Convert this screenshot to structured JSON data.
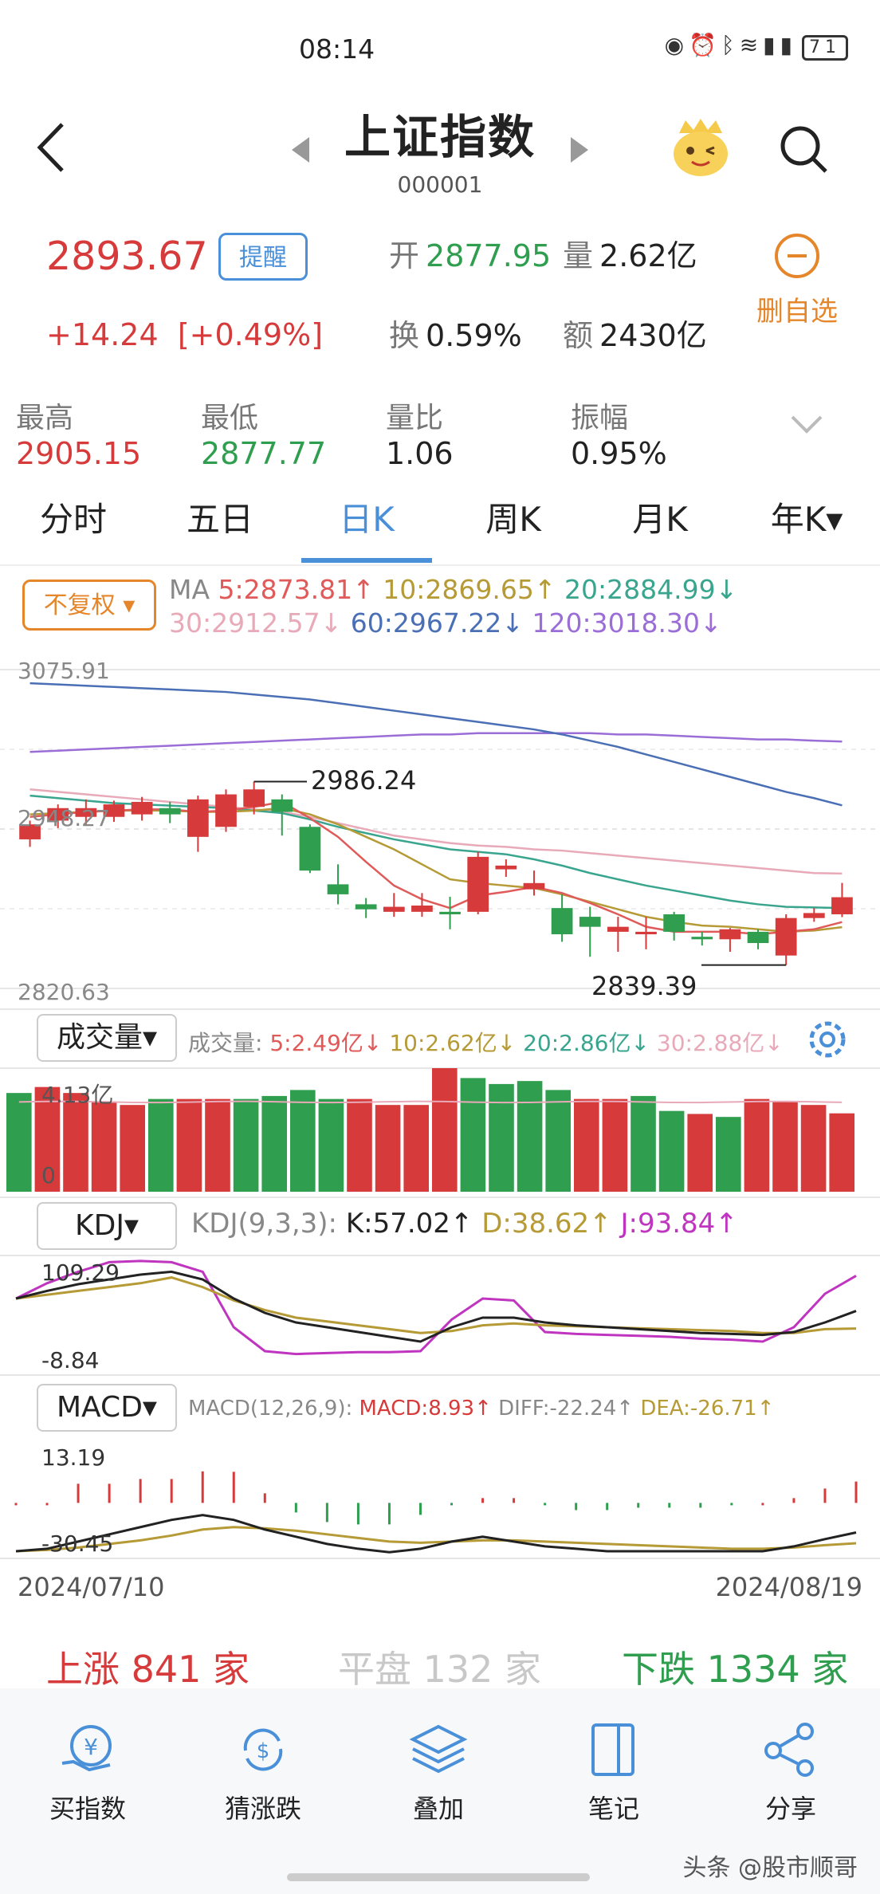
{
  "status_bar": {
    "time": "08:14",
    "battery": "71"
  },
  "header": {
    "title": "上证指数",
    "code": "000001"
  },
  "quote": {
    "price": "2893.67",
    "alert_label": "提醒",
    "change": "+14.24",
    "change_pct": "[+0.49%]",
    "open_label": "开",
    "open": "2877.95",
    "volume_label": "量",
    "volume": "2.62亿",
    "turnover_label": "换",
    "turnover": "0.59%",
    "amount_label": "额",
    "amount": "2430亿",
    "remove_watchlist": "删自选"
  },
  "stats": [
    {
      "label": "最高",
      "value": "2905.15",
      "color": "#d63a3a"
    },
    {
      "label": "最低",
      "value": "2877.77",
      "color": "#2f9e4f"
    },
    {
      "label": "量比",
      "value": "1.06",
      "color": "#222222"
    },
    {
      "label": "振幅",
      "value": "0.95%",
      "color": "#222222"
    }
  ],
  "tabs": [
    "分时",
    "五日",
    "日K",
    "周K",
    "月K",
    "年K▾"
  ],
  "active_tab": "日K",
  "kline": {
    "adjust_label": "不复权",
    "ma_prefix": "MA",
    "ma5": "5:2873.81↑",
    "ma10": "10:2869.65↑",
    "ma20": "20:2884.99↓",
    "ma30": "30:2912.57↓",
    "ma60": "60:2967.22↓",
    "ma120": "120:3018.30↓",
    "y_top": "3075.91",
    "y_mid": "2948.27",
    "y_bottom": "2820.63",
    "max_annotation": "2986.24",
    "min_annotation": "2839.39"
  },
  "volume": {
    "selector": "成交量▾",
    "line": "成交量: ",
    "v5": "5:2.49亿↓",
    "v10": "10:2.62亿↓",
    "v20": "20:2.86亿↓",
    "v30": "30:2.88亿↓",
    "y_top": "4.13亿",
    "y_bottom": "0"
  },
  "kdj": {
    "selector": "KDJ▾",
    "params": "KDJ(9,3,3):",
    "k": "K:57.02↑",
    "d": "D:38.62↑",
    "j": "J:93.84↑",
    "y_top": "109.29",
    "y_bottom": "-8.84"
  },
  "macd": {
    "selector": "MACD▾",
    "params": "MACD(12,26,9):",
    "macd": "MACD:8.93↑",
    "diff": "DIFF:-22.24↑",
    "dea": "DEA:-26.71↑",
    "y_top": "13.19",
    "y_bottom": "-30.45"
  },
  "dates": {
    "start": "2024/07/10",
    "end": "2024/08/19"
  },
  "breadth": {
    "up": "上涨 841 家",
    "flat": "平盘 132 家",
    "down": "下跌 1334 家"
  },
  "bottom_nav": [
    "买指数",
    "猜涨跌",
    "叠加",
    "笔记",
    "分享"
  ],
  "watermark": "头条 @股市顺哥",
  "colors": {
    "up": "#d63a3a",
    "down": "#2f9e4f",
    "accent": "#4a90d9",
    "orange": "#e5862a"
  },
  "chart_data": {
    "type": "candlestick",
    "x_range": [
      "2024/07/10",
      "2024/08/19"
    ],
    "ylim": [
      2820.63,
      3075.91
    ],
    "candles": [
      {
        "o": 2940,
        "c": 2952,
        "h": 2955,
        "l": 2934
      },
      {
        "o": 2955,
        "c": 2965,
        "h": 2968,
        "l": 2949
      },
      {
        "o": 2958,
        "c": 2965,
        "h": 2972,
        "l": 2951
      },
      {
        "o": 2958,
        "c": 2968,
        "h": 2971,
        "l": 2954
      },
      {
        "o": 2960,
        "c": 2970,
        "h": 2974,
        "l": 2955
      },
      {
        "o": 2965,
        "c": 2960,
        "h": 2970,
        "l": 2953
      },
      {
        "o": 2942,
        "c": 2972,
        "h": 2975,
        "l": 2930
      },
      {
        "o": 2950,
        "c": 2976,
        "h": 2980,
        "l": 2946
      },
      {
        "o": 2966,
        "c": 2980,
        "h": 2986.24,
        "l": 2960
      },
      {
        "o": 2972,
        "c": 2962,
        "h": 2976,
        "l": 2943
      },
      {
        "o": 2950,
        "c": 2915,
        "h": 2952,
        "l": 2913
      },
      {
        "o": 2904,
        "c": 2896,
        "h": 2920,
        "l": 2888
      },
      {
        "o": 2888,
        "c": 2884,
        "h": 2893,
        "l": 2877
      },
      {
        "o": 2882,
        "c": 2886,
        "h": 2897,
        "l": 2878
      },
      {
        "o": 2882,
        "c": 2887,
        "h": 2897,
        "l": 2878
      },
      {
        "o": 2882,
        "c": 2880,
        "h": 2894,
        "l": 2868
      },
      {
        "o": 2882,
        "c": 2926,
        "h": 2930,
        "l": 2880
      },
      {
        "o": 2916,
        "c": 2919,
        "h": 2924,
        "l": 2910
      },
      {
        "o": 2900,
        "c": 2905,
        "h": 2915,
        "l": 2895
      },
      {
        "o": 2885,
        "c": 2864,
        "h": 2896,
        "l": 2858
      },
      {
        "o": 2878,
        "c": 2870,
        "h": 2886,
        "l": 2846
      },
      {
        "o": 2866,
        "c": 2870,
        "h": 2878,
        "l": 2850
      },
      {
        "o": 2864,
        "c": 2866,
        "h": 2878,
        "l": 2852
      },
      {
        "o": 2880,
        "c": 2866,
        "h": 2882,
        "l": 2859
      },
      {
        "o": 2862,
        "c": 2860,
        "h": 2866,
        "l": 2855
      },
      {
        "o": 2860,
        "c": 2868,
        "h": 2869,
        "l": 2850
      },
      {
        "o": 2866,
        "c": 2857,
        "h": 2868,
        "l": 2852
      },
      {
        "o": 2847,
        "c": 2877,
        "h": 2880,
        "l": 2839.39
      },
      {
        "o": 2877,
        "c": 2881,
        "h": 2885,
        "l": 2874
      },
      {
        "o": 2880,
        "c": 2893.67,
        "h": 2905.15,
        "l": 2877.77
      }
    ],
    "ma_lines": [
      {
        "name": "MA120",
        "color": "#9b6dd6",
        "values": [
          3010,
          3011,
          3012,
          3013,
          3014,
          3015,
          3016,
          3017,
          3018,
          3019,
          3020,
          3021,
          3022,
          3023,
          3024,
          3024,
          3025,
          3025,
          3025,
          3025,
          3025,
          3024,
          3024,
          3023,
          3022,
          3021,
          3020,
          3020,
          3019,
          3018.3
        ]
      },
      {
        "name": "MA60",
        "color": "#4a6fb5",
        "values": [
          3065,
          3064,
          3063,
          3062,
          3061,
          3060,
          3059,
          3058,
          3056,
          3054,
          3052,
          3049,
          3046,
          3043,
          3040,
          3037,
          3034,
          3031,
          3028,
          3024,
          3019,
          3014,
          3008,
          3002,
          2996,
          2990,
          2984,
          2978,
          2973,
          2967.2
        ]
      },
      {
        "name": "MA30",
        "color": "#e8a9b8",
        "values": [
          2980,
          2978,
          2976,
          2974,
          2972,
          2970,
          2968,
          2966,
          2964,
          2962,
          2958,
          2953,
          2948,
          2943,
          2940,
          2937,
          2935,
          2934,
          2932,
          2931,
          2929,
          2927,
          2925,
          2923,
          2921,
          2919,
          2917,
          2915,
          2913,
          2912.6
        ]
      },
      {
        "name": "MA20",
        "color": "#3aa58e",
        "values": [
          2975,
          2973,
          2971,
          2969,
          2968,
          2967,
          2966,
          2965,
          2963,
          2961,
          2956,
          2950,
          2945,
          2940,
          2936,
          2932,
          2930,
          2928,
          2924,
          2919,
          2913,
          2908,
          2903,
          2899,
          2895,
          2891,
          2888,
          2886,
          2885.5,
          2885
        ]
      },
      {
        "name": "MA10",
        "color": "#b59a36",
        "values": [
          2960,
          2961,
          2962,
          2963,
          2963,
          2963,
          2962,
          2962,
          2963,
          2965,
          2960,
          2952,
          2942,
          2932,
          2920,
          2908,
          2905,
          2903,
          2901,
          2896,
          2890,
          2884,
          2878,
          2874,
          2871,
          2870,
          2868,
          2866,
          2867,
          2869.7
        ]
      },
      {
        "name": "MA5",
        "color": "#e05a5a",
        "values": [
          2958,
          2960,
          2962,
          2963,
          2964,
          2964,
          2962,
          2963,
          2966,
          2970,
          2957,
          2942,
          2922,
          2903,
          2892,
          2885,
          2895,
          2898,
          2902,
          2897,
          2889,
          2880,
          2870,
          2866,
          2866,
          2866,
          2864,
          2866,
          2868,
          2873.8
        ]
      }
    ],
    "volumes": [
      {
        "v": 3.3,
        "up": false
      },
      {
        "v": 3.5,
        "up": true
      },
      {
        "v": 3.3,
        "up": true
      },
      {
        "v": 3.0,
        "up": true
      },
      {
        "v": 2.9,
        "up": true
      },
      {
        "v": 3.1,
        "up": false
      },
      {
        "v": 3.1,
        "up": true
      },
      {
        "v": 3.1,
        "up": true
      },
      {
        "v": 3.1,
        "up": false
      },
      {
        "v": 3.2,
        "up": false
      },
      {
        "v": 3.4,
        "up": false
      },
      {
        "v": 3.1,
        "up": false
      },
      {
        "v": 3.1,
        "up": true
      },
      {
        "v": 2.9,
        "up": true
      },
      {
        "v": 2.9,
        "up": true
      },
      {
        "v": 4.13,
        "up": true
      },
      {
        "v": 3.8,
        "up": false
      },
      {
        "v": 3.6,
        "up": false
      },
      {
        "v": 3.7,
        "up": false
      },
      {
        "v": 3.4,
        "up": false
      },
      {
        "v": 3.1,
        "up": true
      },
      {
        "v": 3.1,
        "up": true
      },
      {
        "v": 3.2,
        "up": false
      },
      {
        "v": 2.7,
        "up": false
      },
      {
        "v": 2.6,
        "up": true
      },
      {
        "v": 2.5,
        "up": false
      },
      {
        "v": 3.1,
        "up": true
      },
      {
        "v": 3.0,
        "up": true
      },
      {
        "v": 2.9,
        "up": true
      },
      {
        "v": 2.62,
        "up": true
      }
    ],
    "kdj": {
      "K": [
        70,
        78,
        85,
        90,
        95,
        98,
        90,
        70,
        55,
        45,
        40,
        35,
        30,
        25,
        40,
        50,
        50,
        45,
        42,
        40,
        38,
        36,
        34,
        33,
        32,
        35,
        45,
        57.02
      ],
      "D": [
        70,
        74,
        78,
        82,
        86,
        92,
        82,
        68,
        58,
        50,
        46,
        42,
        38,
        34,
        36,
        42,
        44,
        42,
        41,
        40,
        39,
        38,
        37,
        36,
        34,
        34,
        38,
        38.62
      ],
      "J": [
        70,
        86,
        98,
        108,
        109.29,
        108,
        98,
        40,
        15,
        12,
        13,
        14,
        14,
        15,
        48,
        70,
        68,
        35,
        33,
        32,
        31,
        30,
        28,
        27,
        25,
        40,
        75,
        93.84
      ]
    },
    "macd": {
      "DIFF": [
        -30,
        -29,
        -26,
        -23,
        -20,
        -17,
        -15,
        -17,
        -21,
        -24,
        -27,
        -29,
        -30.45,
        -29,
        -26,
        -24,
        -26,
        -28,
        -29,
        -30,
        -30,
        -30,
        -30,
        -30,
        -30,
        -28,
        -25,
        -22.24
      ],
      "DEA": [
        -30,
        -29.5,
        -28.5,
        -27,
        -25.5,
        -23.5,
        -21,
        -20,
        -20.5,
        -21.5,
        -23,
        -24.5,
        -26,
        -26.5,
        -26,
        -25.5,
        -25.5,
        -26,
        -26.5,
        -27,
        -27.5,
        -28,
        -28.5,
        -29,
        -29,
        -28.5,
        -27.5,
        -26.71
      ],
      "HIST": [
        0,
        0,
        8,
        8,
        10,
        10,
        13.19,
        13,
        4,
        -4,
        -8,
        -9,
        -9,
        -5,
        -1,
        2,
        2,
        -1,
        -3,
        -3,
        -2,
        -2,
        -2,
        -1,
        0,
        2,
        6,
        8.93
      ]
    }
  }
}
